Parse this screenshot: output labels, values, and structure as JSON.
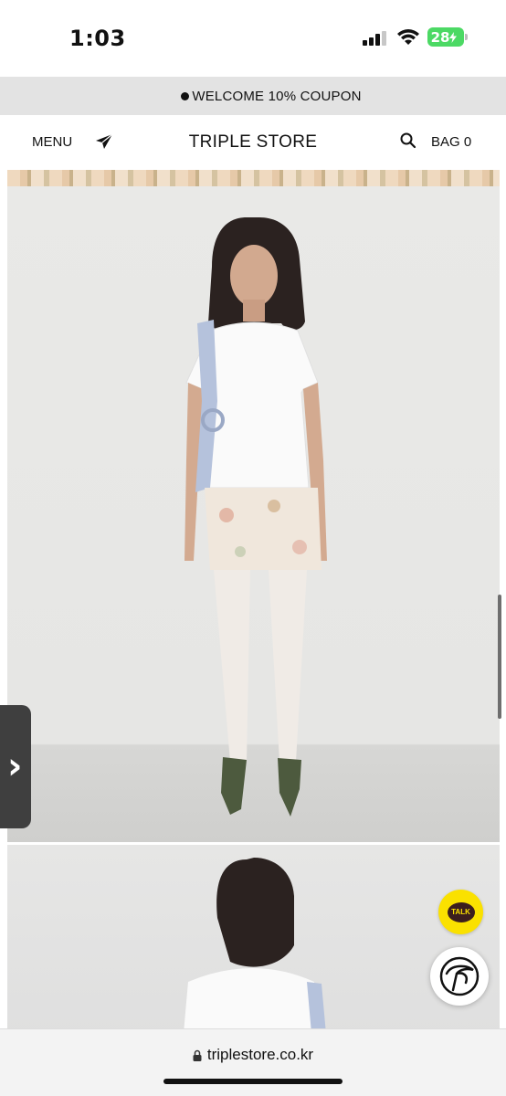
{
  "status_bar": {
    "time": "1:03",
    "battery_level": "28",
    "icons": [
      "signal-icon",
      "wifi-icon",
      "battery-icon"
    ]
  },
  "promo": {
    "text": "WELCOME 10% COUPON"
  },
  "header": {
    "menu_label": "MENU",
    "logo": "TRIPLE STORE",
    "bag_label": "BAG 0",
    "icons": [
      "send-icon",
      "search-icon"
    ]
  },
  "floating": {
    "talk_label": "TALK",
    "side_tab_icon": "chevron-right-icon"
  },
  "browser": {
    "url": "triplestore.co.kr",
    "icons": [
      "lock-icon"
    ]
  },
  "colors": {
    "promo_bg": "#e3e3e3",
    "kakao_yellow": "#fae100",
    "battery_green": "#4cd964"
  }
}
